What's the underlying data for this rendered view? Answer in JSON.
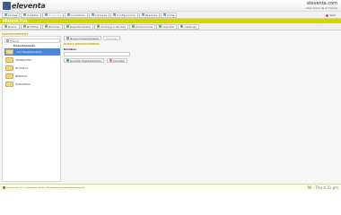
{
  "header": {
    "logo_text": "eleventa",
    "logo_subtitle": "punto de venta",
    "site": "eleventa.com",
    "shop_name": "Abarrotera de la Tienda"
  },
  "main_nav": {
    "items": [
      {
        "label": "Ventas",
        "enabled": true
      },
      {
        "label": "Créditos",
        "enabled": true
      },
      {
        "label": "Productos",
        "enabled": false
      },
      {
        "label": "Inventario",
        "enabled": true
      },
      {
        "label": "Compras",
        "enabled": true
      },
      {
        "label": "Configuración",
        "enabled": true
      },
      {
        "label": "Reportes",
        "enabled": true
      },
      {
        "label": "Corte",
        "enabled": true
      }
    ],
    "exit_label": "Salir"
  },
  "section_title": "PRODUCTOS",
  "toolbar": {
    "items": [
      "Nuevo",
      "Modificar",
      "Eliminar",
      "Departamentos",
      "Ventas por Periodo",
      "Promociones",
      "Importar",
      "Catálogo"
    ]
  },
  "content_title": "DEPARTAMENTOS",
  "left_panel": {
    "search_placeholder": "Buscar",
    "column_header": "Departamento",
    "departments": [
      {
        "name": "- Sin Departamento -",
        "selected": true
      },
      {
        "name": "ABARROTES",
        "selected": false
      },
      {
        "name": "BOTANAS",
        "selected": false
      },
      {
        "name": "BEBIDAS",
        "selected": false
      },
      {
        "name": "PANADERIA",
        "selected": false
      }
    ]
  },
  "right_panel": {
    "tabs": [
      {
        "label": "Nuevo Departamento",
        "enabled": true
      },
      {
        "label": "Eliminar",
        "enabled": false
      }
    ],
    "form_title": "NUEVO DEPARTAMENTO",
    "name_label": "Nombre:",
    "name_value": "",
    "ok_label": "Guardar Departamento",
    "cancel_label": "Cancelar"
  },
  "status_bar": {
    "text": "eleventa.com  v 5.0 - Licencia para uso libre. Reportar errores a soporte@eleventa.com",
    "datetime": "Mi - Thu  4:31 pm"
  },
  "colors": {
    "section_bar": "#d4d400",
    "selected_row": "#4a86d8",
    "heading_accent": "#c9a800"
  }
}
